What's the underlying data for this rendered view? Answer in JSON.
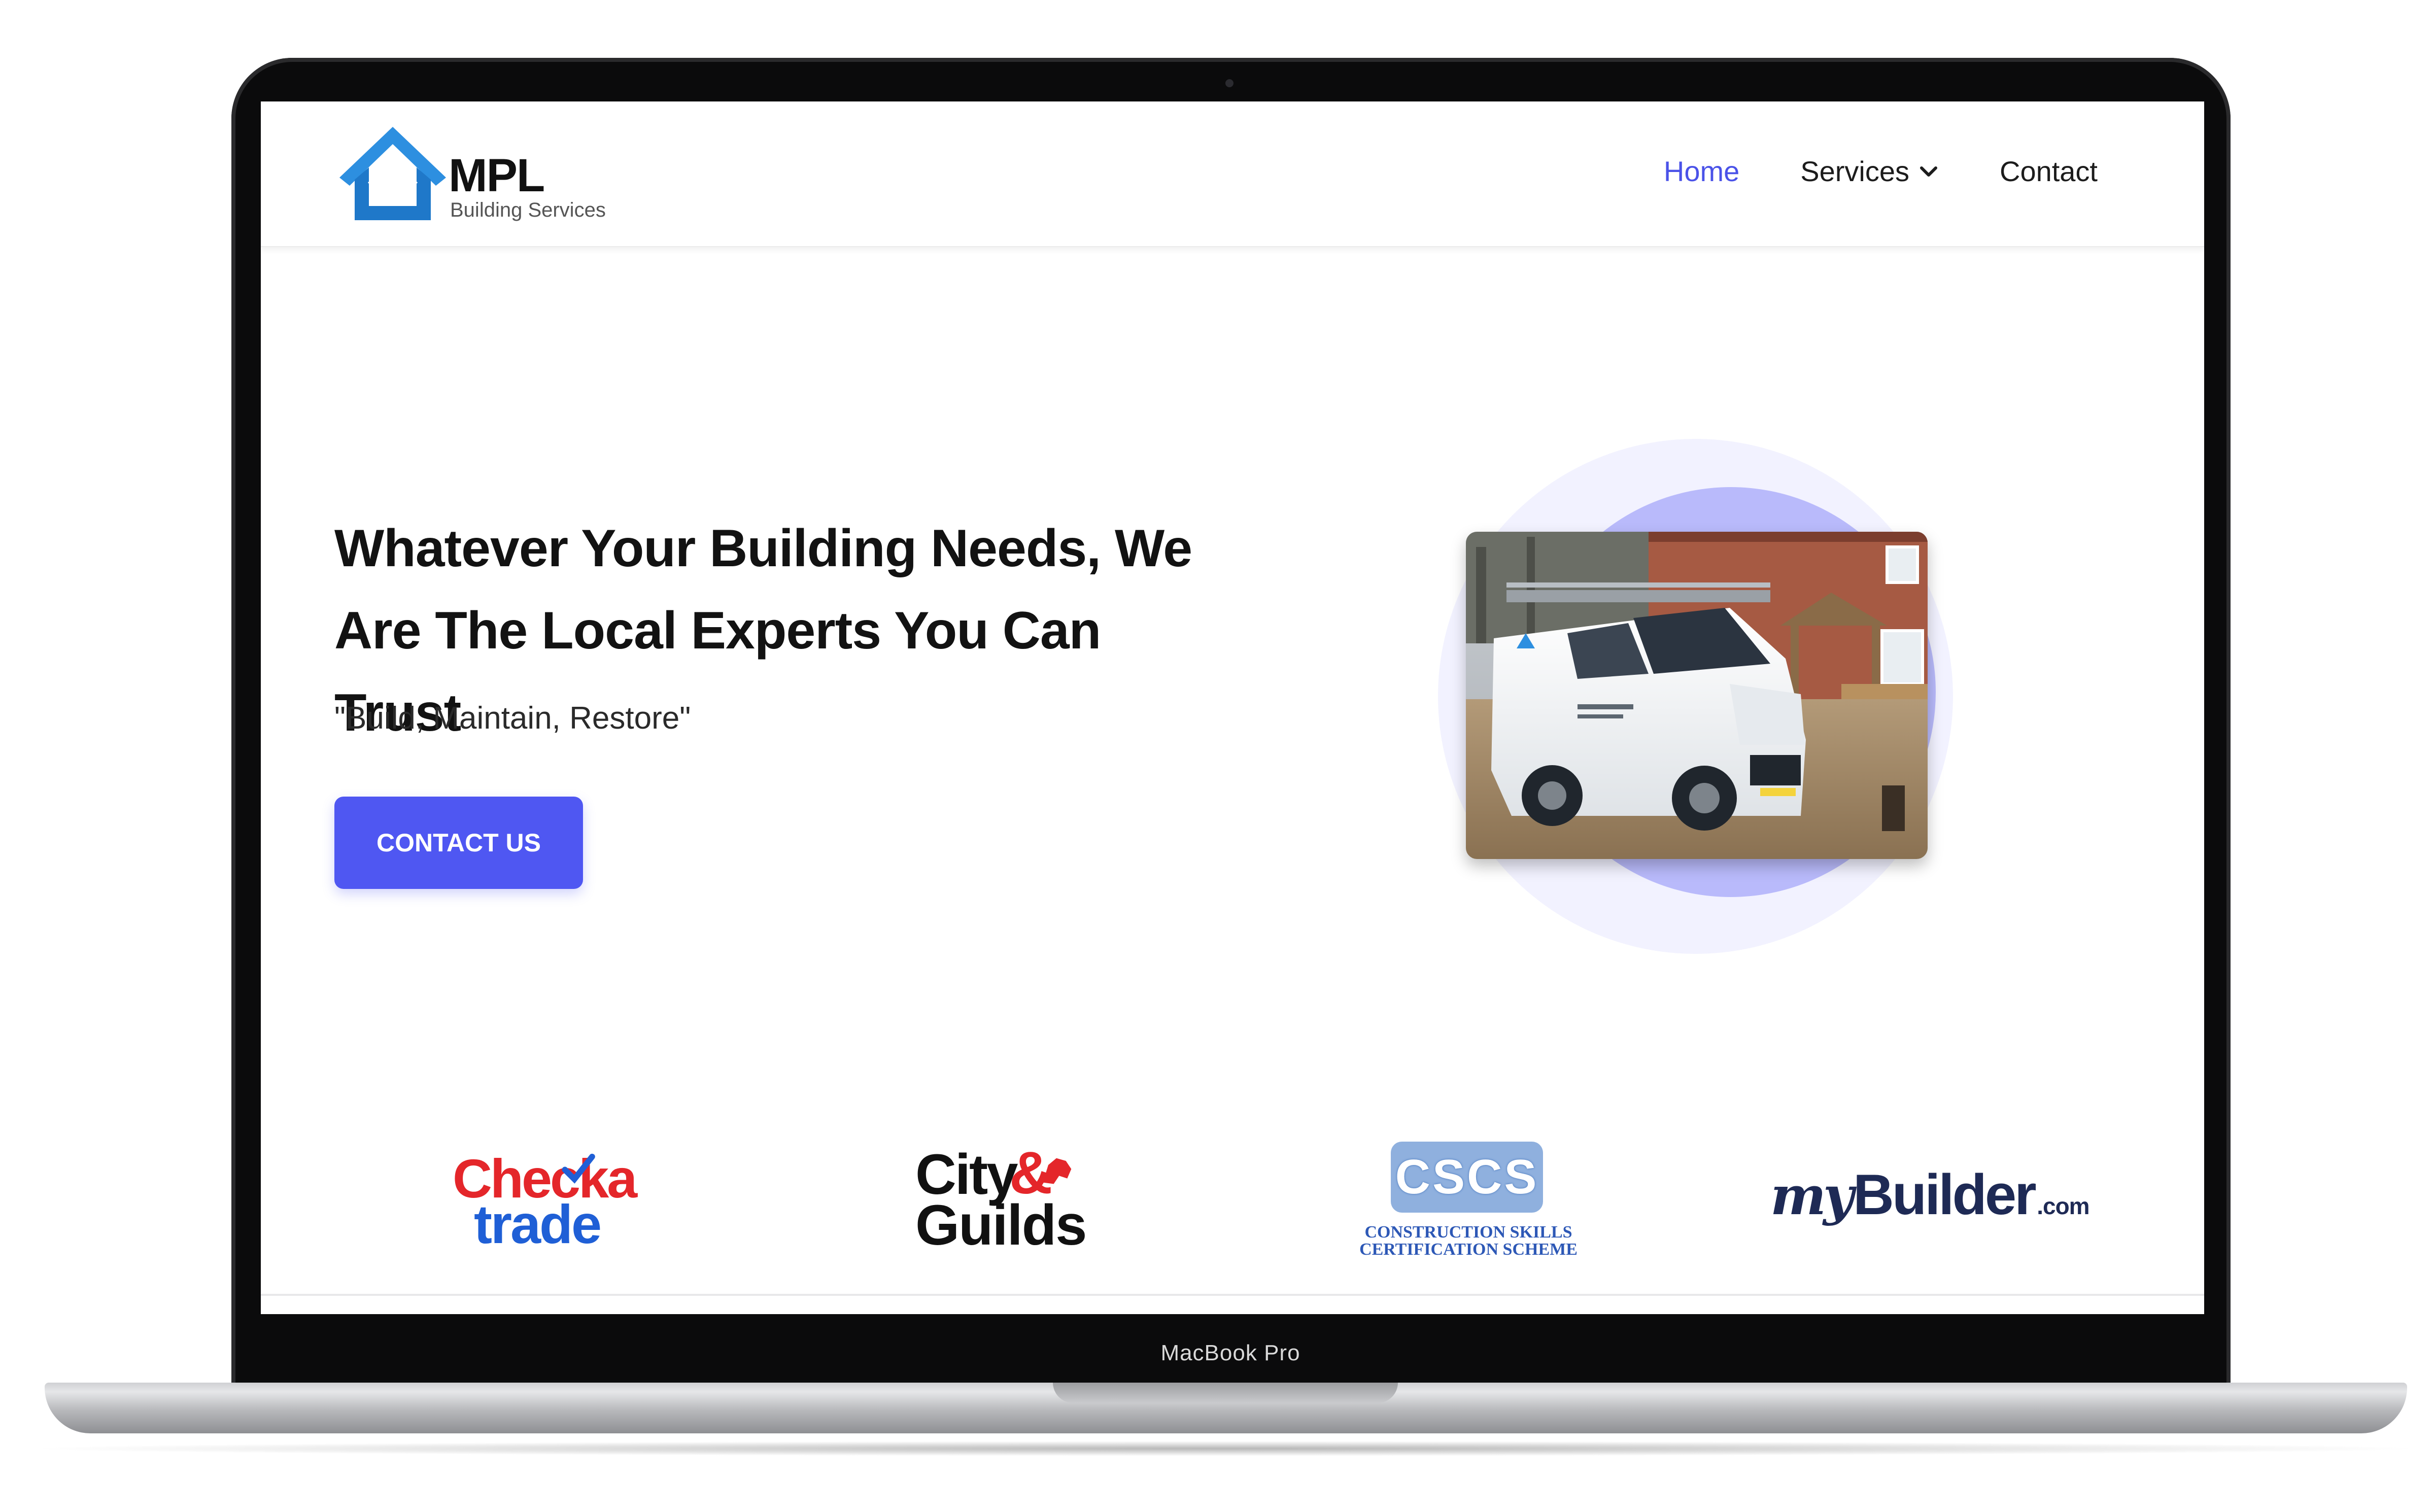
{
  "device": {
    "model_label": "MacBook Pro"
  },
  "site": {
    "logo": {
      "name": "MPL",
      "subtitle": "Building Services"
    },
    "nav": [
      {
        "label": "Home",
        "active": true
      },
      {
        "label": "Services",
        "has_dropdown": true
      },
      {
        "label": "Contact"
      }
    ]
  },
  "hero": {
    "title_line1": "Whatever Your Building Needs, We",
    "title_line2": "Are The Local Experts You Can Trust",
    "tagline": "\"Build, Maintain, Restore\"",
    "cta_label": "CONTACT US"
  },
  "accreditations": [
    {
      "name": "Checkatrade",
      "line1": "Checka",
      "line2": "trade"
    },
    {
      "name": "City & Guilds",
      "line1": "City",
      "line2": "Guilds",
      "amp": "&"
    },
    {
      "name": "CSCS",
      "mark": "CSCS",
      "line1": "CONSTRUCTION SKILLS",
      "line2": "CERTIFICATION SCHEME"
    },
    {
      "name": "MyBuilder",
      "my": "my",
      "builder": "Builder",
      "tld": ".com"
    }
  ],
  "colors": {
    "accent": "#4f57f2",
    "nav_active": "#4a52e8",
    "logo_blue": "#2d8fe0",
    "checkatrade_red": "#e4262a",
    "checkatrade_blue": "#1f5fd6",
    "mybuilder_navy": "#1e2a55"
  }
}
